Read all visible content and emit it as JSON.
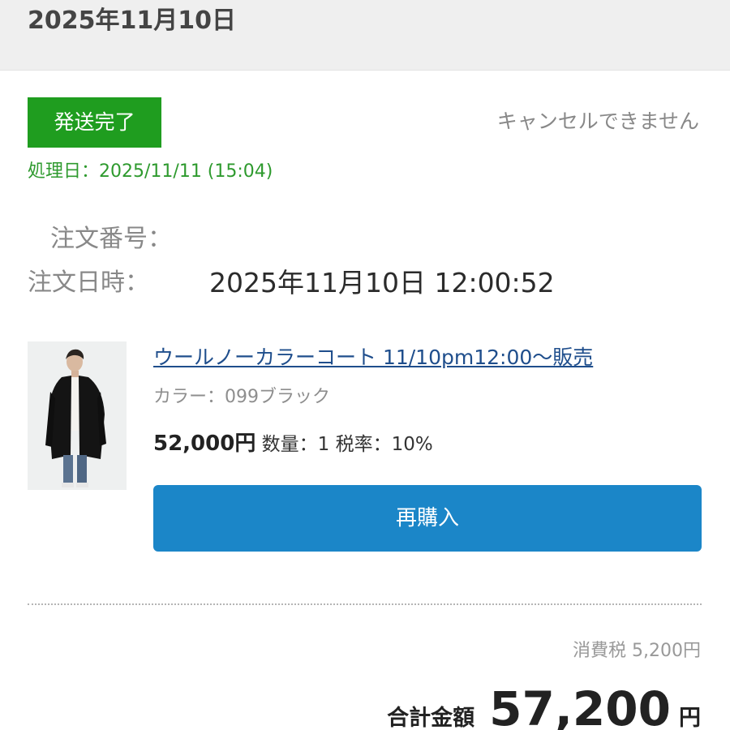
{
  "header": {
    "date": "2025年11月10日"
  },
  "order": {
    "status": "発送完了",
    "cancel_note": "キャンセルできません",
    "processed_label": "処理日：",
    "processed_value": "2025/11/11 (15:04)",
    "number_label": "注文番号：",
    "number_value": "",
    "datetime_label": "注文日時：",
    "datetime_value": "2025年11月10日 12:00:52"
  },
  "item": {
    "title": "ウールノーカラーコート 11/10pm12:00〜販売",
    "color_label": "カラー：",
    "color_value": "099ブラック",
    "price": "52,000円",
    "quantity_label": "数量：",
    "quantity_value": "1",
    "tax_rate_label": "税率：",
    "tax_rate_value": "10%",
    "rebuy_label": "再購入"
  },
  "summary": {
    "tax_label": "消費税",
    "tax_value": "5,200円",
    "total_label": "合計金額",
    "total_amount": "57,200",
    "total_unit": "円"
  },
  "colors": {
    "status_green": "#1f9d1f",
    "processed_green": "#2e9a2e",
    "button_blue": "#1b86c8",
    "link_blue": "#1f4e8c",
    "header_bg": "#efefef"
  },
  "icons": {
    "product_image": "coat-model-photo"
  }
}
